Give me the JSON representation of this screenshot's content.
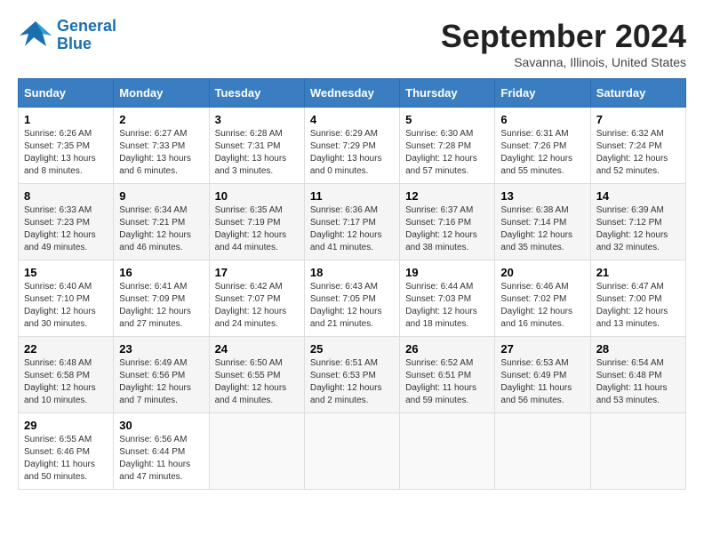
{
  "header": {
    "logo_line1": "General",
    "logo_line2": "Blue",
    "month": "September 2024",
    "location": "Savanna, Illinois, United States"
  },
  "columns": [
    "Sunday",
    "Monday",
    "Tuesday",
    "Wednesday",
    "Thursday",
    "Friday",
    "Saturday"
  ],
  "weeks": [
    [
      {
        "day": "1",
        "sunrise": "6:26 AM",
        "sunset": "7:35 PM",
        "daylight": "13 hours and 8 minutes."
      },
      {
        "day": "2",
        "sunrise": "6:27 AM",
        "sunset": "7:33 PM",
        "daylight": "13 hours and 6 minutes."
      },
      {
        "day": "3",
        "sunrise": "6:28 AM",
        "sunset": "7:31 PM",
        "daylight": "13 hours and 3 minutes."
      },
      {
        "day": "4",
        "sunrise": "6:29 AM",
        "sunset": "7:29 PM",
        "daylight": "13 hours and 0 minutes."
      },
      {
        "day": "5",
        "sunrise": "6:30 AM",
        "sunset": "7:28 PM",
        "daylight": "12 hours and 57 minutes."
      },
      {
        "day": "6",
        "sunrise": "6:31 AM",
        "sunset": "7:26 PM",
        "daylight": "12 hours and 55 minutes."
      },
      {
        "day": "7",
        "sunrise": "6:32 AM",
        "sunset": "7:24 PM",
        "daylight": "12 hours and 52 minutes."
      }
    ],
    [
      {
        "day": "8",
        "sunrise": "6:33 AM",
        "sunset": "7:23 PM",
        "daylight": "12 hours and 49 minutes."
      },
      {
        "day": "9",
        "sunrise": "6:34 AM",
        "sunset": "7:21 PM",
        "daylight": "12 hours and 46 minutes."
      },
      {
        "day": "10",
        "sunrise": "6:35 AM",
        "sunset": "7:19 PM",
        "daylight": "12 hours and 44 minutes."
      },
      {
        "day": "11",
        "sunrise": "6:36 AM",
        "sunset": "7:17 PM",
        "daylight": "12 hours and 41 minutes."
      },
      {
        "day": "12",
        "sunrise": "6:37 AM",
        "sunset": "7:16 PM",
        "daylight": "12 hours and 38 minutes."
      },
      {
        "day": "13",
        "sunrise": "6:38 AM",
        "sunset": "7:14 PM",
        "daylight": "12 hours and 35 minutes."
      },
      {
        "day": "14",
        "sunrise": "6:39 AM",
        "sunset": "7:12 PM",
        "daylight": "12 hours and 32 minutes."
      }
    ],
    [
      {
        "day": "15",
        "sunrise": "6:40 AM",
        "sunset": "7:10 PM",
        "daylight": "12 hours and 30 minutes."
      },
      {
        "day": "16",
        "sunrise": "6:41 AM",
        "sunset": "7:09 PM",
        "daylight": "12 hours and 27 minutes."
      },
      {
        "day": "17",
        "sunrise": "6:42 AM",
        "sunset": "7:07 PM",
        "daylight": "12 hours and 24 minutes."
      },
      {
        "day": "18",
        "sunrise": "6:43 AM",
        "sunset": "7:05 PM",
        "daylight": "12 hours and 21 minutes."
      },
      {
        "day": "19",
        "sunrise": "6:44 AM",
        "sunset": "7:03 PM",
        "daylight": "12 hours and 18 minutes."
      },
      {
        "day": "20",
        "sunrise": "6:46 AM",
        "sunset": "7:02 PM",
        "daylight": "12 hours and 16 minutes."
      },
      {
        "day": "21",
        "sunrise": "6:47 AM",
        "sunset": "7:00 PM",
        "daylight": "12 hours and 13 minutes."
      }
    ],
    [
      {
        "day": "22",
        "sunrise": "6:48 AM",
        "sunset": "6:58 PM",
        "daylight": "12 hours and 10 minutes."
      },
      {
        "day": "23",
        "sunrise": "6:49 AM",
        "sunset": "6:56 PM",
        "daylight": "12 hours and 7 minutes."
      },
      {
        "day": "24",
        "sunrise": "6:50 AM",
        "sunset": "6:55 PM",
        "daylight": "12 hours and 4 minutes."
      },
      {
        "day": "25",
        "sunrise": "6:51 AM",
        "sunset": "6:53 PM",
        "daylight": "12 hours and 2 minutes."
      },
      {
        "day": "26",
        "sunrise": "6:52 AM",
        "sunset": "6:51 PM",
        "daylight": "11 hours and 59 minutes."
      },
      {
        "day": "27",
        "sunrise": "6:53 AM",
        "sunset": "6:49 PM",
        "daylight": "11 hours and 56 minutes."
      },
      {
        "day": "28",
        "sunrise": "6:54 AM",
        "sunset": "6:48 PM",
        "daylight": "11 hours and 53 minutes."
      }
    ],
    [
      {
        "day": "29",
        "sunrise": "6:55 AM",
        "sunset": "6:46 PM",
        "daylight": "11 hours and 50 minutes."
      },
      {
        "day": "30",
        "sunrise": "6:56 AM",
        "sunset": "6:44 PM",
        "daylight": "11 hours and 47 minutes."
      },
      null,
      null,
      null,
      null,
      null
    ]
  ]
}
